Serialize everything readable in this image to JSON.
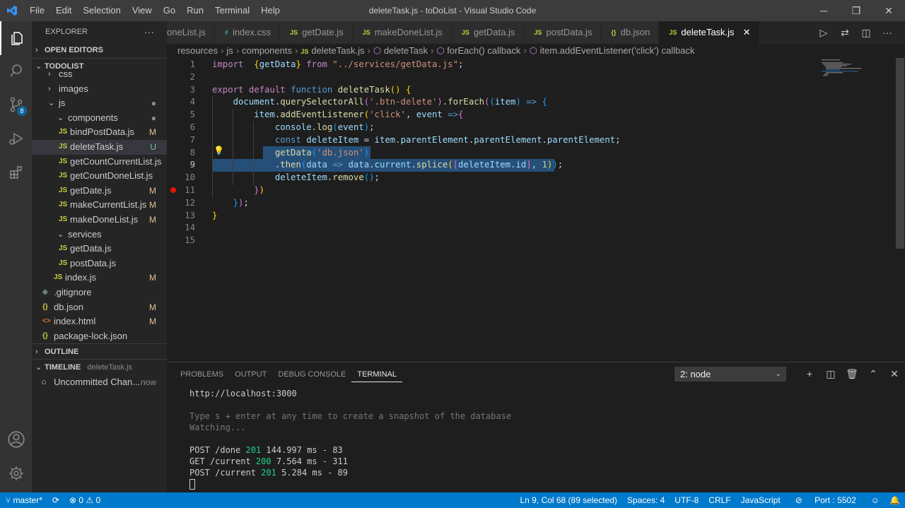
{
  "window": {
    "title": "deleteTask.js - toDoList - Visual Studio Code",
    "menu": [
      "File",
      "Edit",
      "Selection",
      "View",
      "Go",
      "Run",
      "Terminal",
      "Help"
    ],
    "controls": [
      "─",
      "❐",
      "✕"
    ]
  },
  "activity": {
    "badge": "8"
  },
  "sidebar": {
    "title": "EXPLORER",
    "more": "···",
    "sections": {
      "open_editors": "OPEN EDITORS",
      "project": "TODOLIST",
      "outline": "OUTLINE",
      "timeline": "TIMELINE"
    },
    "timeline_file": "deleteTask.js",
    "timeline_item": {
      "label": "Uncommitted Chan...",
      "time": "now"
    },
    "tree": [
      {
        "label": "css",
        "indent": 1,
        "type": "folder",
        "chev": "›",
        "status": ""
      },
      {
        "label": "images",
        "indent": 1,
        "type": "folder",
        "chev": "›",
        "status": ""
      },
      {
        "label": "js",
        "indent": 1,
        "type": "folder",
        "chev": "⌄",
        "status": "●"
      },
      {
        "label": "components",
        "indent": 2,
        "type": "folder",
        "chev": "⌄",
        "status": "●"
      },
      {
        "label": "bindPostData.js",
        "indent": 3,
        "type": "js",
        "status": "M"
      },
      {
        "label": "deleteTask.js",
        "indent": 3,
        "type": "js",
        "status": "U"
      },
      {
        "label": "getCountCurrentList.js",
        "indent": 3,
        "type": "js",
        "status": ""
      },
      {
        "label": "getCountDoneList.js",
        "indent": 3,
        "type": "js",
        "status": ""
      },
      {
        "label": "getDate.js",
        "indent": 3,
        "type": "js",
        "status": "M"
      },
      {
        "label": "makeCurrentList.js",
        "indent": 3,
        "type": "js",
        "status": "M"
      },
      {
        "label": "makeDoneList.js",
        "indent": 3,
        "type": "js",
        "status": "M"
      },
      {
        "label": "services",
        "indent": 2,
        "type": "folder",
        "chev": "⌄",
        "status": ""
      },
      {
        "label": "getData.js",
        "indent": 3,
        "type": "js",
        "status": ""
      },
      {
        "label": "postData.js",
        "indent": 3,
        "type": "js",
        "status": ""
      },
      {
        "label": "index.js",
        "indent": 2,
        "type": "js",
        "status": "M"
      },
      {
        "label": ".gitignore",
        "indent": 1,
        "type": "git",
        "status": ""
      },
      {
        "label": "db.json",
        "indent": 1,
        "type": "json",
        "status": "M"
      },
      {
        "label": "index.html",
        "indent": 1,
        "type": "html",
        "status": "M"
      },
      {
        "label": "package-lock.json",
        "indent": 1,
        "type": "json",
        "status": ""
      }
    ]
  },
  "tabs": [
    {
      "label": "oneList.js",
      "icon": "JS"
    },
    {
      "label": "index.css",
      "icon": "#"
    },
    {
      "label": "getDate.js",
      "icon": "JS"
    },
    {
      "label": "makeDoneList.js",
      "icon": "JS"
    },
    {
      "label": "getData.js",
      "icon": "JS"
    },
    {
      "label": "postData.js",
      "icon": "JS"
    },
    {
      "label": "db.json",
      "icon": "{}"
    },
    {
      "label": "deleteTask.js",
      "icon": "JS",
      "active": true,
      "close": "✕"
    }
  ],
  "breadcrumb": [
    "resources",
    "js",
    "components",
    "deleteTask.js",
    "deleteTask",
    "forEach() callback",
    "item.addEventListener('click') callback"
  ],
  "editor": {
    "line_numbers": [
      "1",
      "2",
      "3",
      "4",
      "5",
      "6",
      "7",
      "8",
      "9",
      "10",
      "11",
      "12",
      "13",
      "14",
      "15"
    ],
    "lines": [
      [
        [
          "kw2",
          "import"
        ],
        [
          "",
          "  "
        ],
        [
          "br1",
          "{"
        ],
        [
          "var",
          "getData"
        ],
        [
          "br1",
          "}"
        ],
        [
          "",
          ""
        ],
        [
          "kw2",
          " from "
        ],
        [
          "str",
          "\"../services/getData.js\""
        ],
        [
          "",
          ";"
        ]
      ],
      [],
      [
        [
          "kw2",
          "export"
        ],
        [
          "",
          " "
        ],
        [
          "kw2",
          "default"
        ],
        [
          "",
          " "
        ],
        [
          "kw",
          "function"
        ],
        [
          "",
          " "
        ],
        [
          "fn",
          "deleteTask"
        ],
        [
          "br1",
          "()"
        ],
        [
          "",
          " "
        ],
        [
          "br1",
          "{"
        ]
      ],
      [
        [
          "",
          "    "
        ],
        [
          "var",
          "document"
        ],
        [
          "",
          "."
        ],
        [
          "fn",
          "querySelectorAll"
        ],
        [
          "br2",
          "("
        ],
        [
          "str",
          "'.btn-delete'"
        ],
        [
          "br2",
          ")"
        ],
        [
          "",
          "."
        ],
        [
          "fn",
          "forEach"
        ],
        [
          "br2",
          "("
        ],
        [
          "br3",
          "("
        ],
        [
          "var",
          "item"
        ],
        [
          "br3",
          ")"
        ],
        [
          "",
          " "
        ],
        [
          "kw",
          "=>"
        ],
        [
          "",
          " "
        ],
        [
          "br3",
          "{"
        ]
      ],
      [
        [
          "",
          "        "
        ],
        [
          "var",
          "item"
        ],
        [
          "",
          "."
        ],
        [
          "fn",
          "addEventListener"
        ],
        [
          "br1",
          "("
        ],
        [
          "str",
          "'click'"
        ],
        [
          ",",
          ","
        ],
        [
          "",
          " "
        ],
        [
          "var",
          "event"
        ],
        [
          "",
          " "
        ],
        [
          "kw",
          "=>"
        ],
        [
          "br2",
          "{"
        ]
      ],
      [
        [
          "",
          "            "
        ],
        [
          "var",
          "console"
        ],
        [
          "",
          "."
        ],
        [
          "fn",
          "log"
        ],
        [
          "br3",
          "("
        ],
        [
          "var",
          "event"
        ],
        [
          "br3",
          ")"
        ],
        [
          "",
          ";"
        ]
      ],
      [
        [
          "",
          "            "
        ],
        [
          "kw",
          "const"
        ],
        [
          "",
          " "
        ],
        [
          "var",
          "deleteItem"
        ],
        [
          "",
          " = "
        ],
        [
          "var",
          "item"
        ],
        [
          "",
          "."
        ],
        [
          "var",
          "parentElement"
        ],
        [
          "",
          "."
        ],
        [
          "var",
          "parentElement"
        ],
        [
          "",
          "."
        ],
        [
          "var",
          "parentElement"
        ],
        [
          "",
          ";"
        ]
      ],
      [
        [
          "",
          "            "
        ],
        [
          "fn",
          "getData"
        ],
        [
          "br3",
          "("
        ],
        [
          "str",
          "'db.json'"
        ],
        [
          "br3",
          ")"
        ]
      ],
      [
        [
          "",
          "            "
        ],
        [
          "",
          "."
        ],
        [
          "fn",
          "then"
        ],
        [
          "br3",
          "("
        ],
        [
          "var",
          "data"
        ],
        [
          "",
          " "
        ],
        [
          "kw",
          "=>"
        ],
        [
          "",
          " "
        ],
        [
          "var",
          "data"
        ],
        [
          "",
          "."
        ],
        [
          "var",
          "current"
        ],
        [
          "",
          "."
        ],
        [
          "fn",
          "splice"
        ],
        [
          "br1",
          "("
        ],
        [
          "br2",
          "["
        ],
        [
          "var",
          "deleteItem"
        ],
        [
          "",
          "."
        ],
        [
          "var",
          "id"
        ],
        [
          "br2",
          "]"
        ],
        [
          "",
          ", "
        ],
        [
          "num",
          "1"
        ],
        [
          "br1",
          ")"
        ],
        [
          "br3",
          ")"
        ],
        [
          "",
          ";"
        ]
      ],
      [
        [
          "",
          "            "
        ],
        [
          "var",
          "deleteItem"
        ],
        [
          "",
          "."
        ],
        [
          "fn",
          "remove"
        ],
        [
          "br3",
          "()"
        ],
        [
          "",
          ";"
        ]
      ],
      [
        [
          "",
          "        "
        ],
        [
          "br2",
          "}"
        ],
        [
          "br1",
          ")"
        ]
      ],
      [
        [
          "",
          "    "
        ],
        [
          "br3",
          "}"
        ],
        [
          "br2",
          ")"
        ],
        [
          "",
          ";"
        ]
      ],
      [
        [
          "br1",
          "}"
        ]
      ],
      [],
      []
    ]
  },
  "panel": {
    "tabs": [
      "PROBLEMS",
      "OUTPUT",
      "DEBUG CONSOLE",
      "TERMINAL"
    ],
    "active_tab": "TERMINAL",
    "terminal_select": "2: node",
    "terminal_lines": [
      {
        "parts": [
          [
            "",
            "http://localhost:3000"
          ]
        ]
      },
      {
        "parts": [
          [
            "",
            ""
          ]
        ]
      },
      {
        "parts": [
          [
            "dim",
            "Type s + enter at any time to create a snapshot of the database"
          ]
        ]
      },
      {
        "parts": [
          [
            "dim",
            "Watching..."
          ]
        ]
      },
      {
        "parts": [
          [
            "",
            ""
          ]
        ]
      },
      {
        "parts": [
          [
            "",
            "POST /done "
          ],
          [
            "green",
            "201"
          ],
          [
            "",
            " 144.997 ms - 83"
          ]
        ]
      },
      {
        "parts": [
          [
            "",
            "GET /current "
          ],
          [
            "green",
            "200"
          ],
          [
            "",
            " 7.564 ms - 311"
          ]
        ]
      },
      {
        "parts": [
          [
            "",
            "POST /current "
          ],
          [
            "green",
            "201"
          ],
          [
            "",
            " 5.284 ms - 89"
          ]
        ]
      }
    ]
  },
  "statusbar": {
    "branch": "master*",
    "sync": "⟳",
    "errors": "0",
    "warnings": "0",
    "position": "Ln 9, Col 68 (89 selected)",
    "spaces": "Spaces: 4",
    "encoding": "UTF-8",
    "eol": "CRLF",
    "language": "JavaScript",
    "port": "Port : 5502"
  },
  "colors": {
    "accent": "#007acc",
    "titlebar": "#3c3c3c",
    "sidebar": "#252526",
    "editor": "#1e1e1e",
    "selection": "#264f78"
  }
}
